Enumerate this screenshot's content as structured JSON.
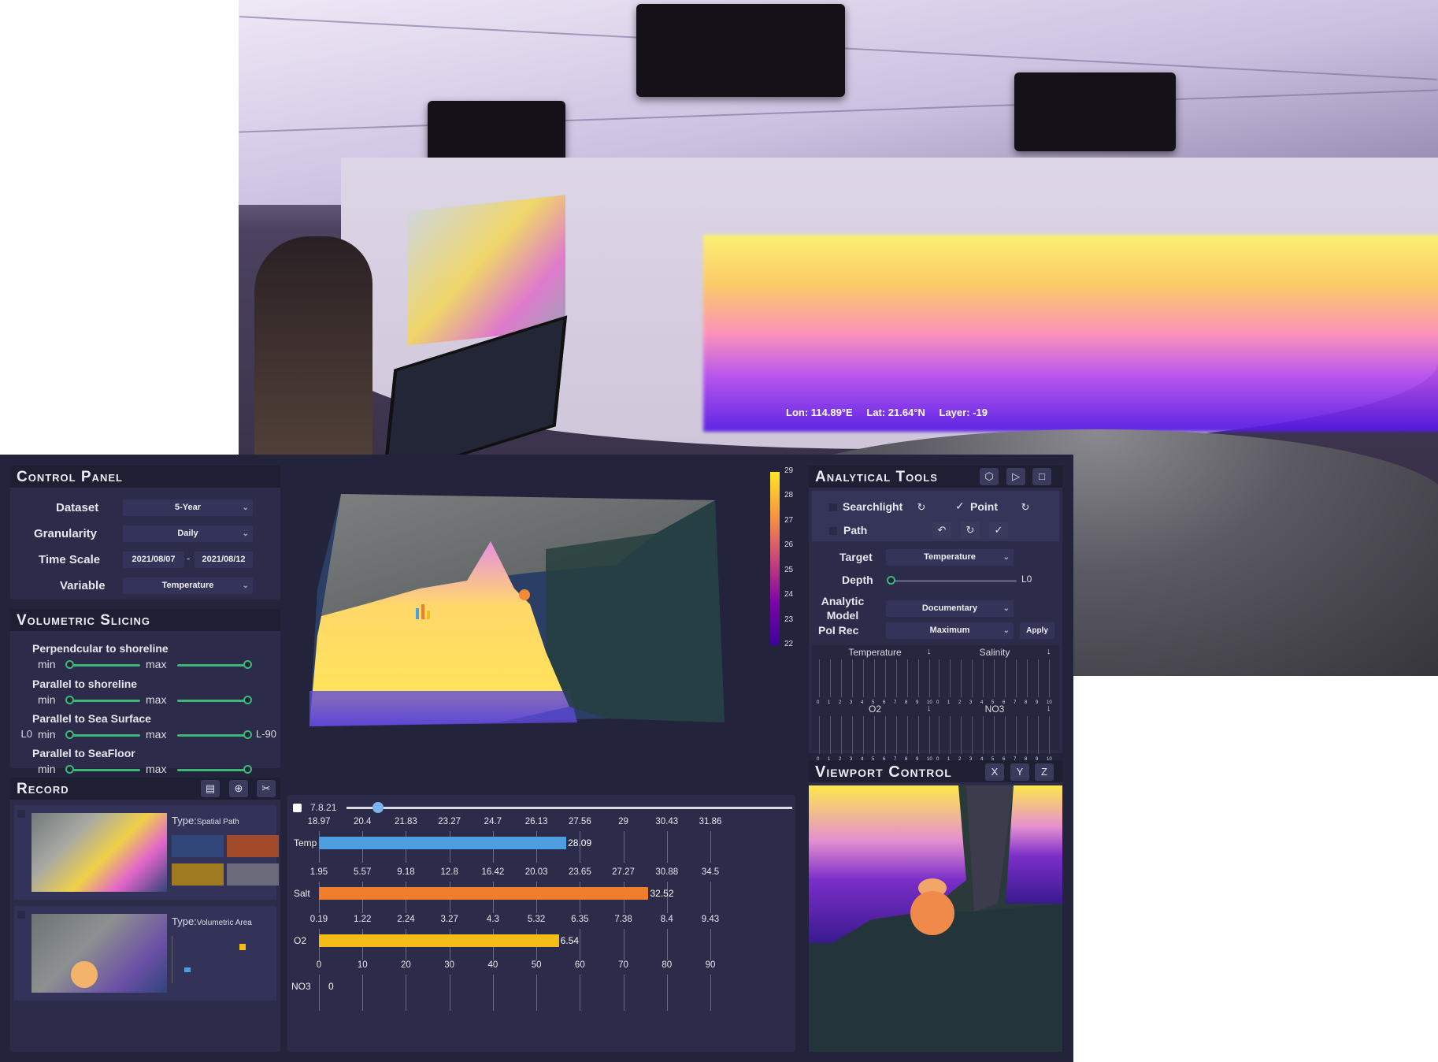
{
  "photo": {
    "lon_label": "Lon: 114.89°E",
    "lat_label": "Lat: 21.64°N",
    "layer_label": "Layer: -19"
  },
  "control_panel": {
    "title": "Control Panel",
    "rows": [
      {
        "label": "Dataset",
        "value": "5-Year"
      },
      {
        "label": "Granularity",
        "value": "Daily"
      },
      {
        "label": "Time Scale",
        "start": "2021/08/07",
        "sep": "-",
        "end": "2021/08/12"
      },
      {
        "label": "Variable",
        "value": "Temperature"
      }
    ]
  },
  "volumetric_slicing": {
    "title": "Volumetric Slicing",
    "sliders": [
      {
        "label": "Perpendcular to shoreline",
        "min_label": "min",
        "max_label": "max",
        "left_note": "",
        "right_note": ""
      },
      {
        "label": "Parallel to shoreline",
        "min_label": "min",
        "max_label": "max",
        "left_note": "",
        "right_note": ""
      },
      {
        "label": "Parallel to Sea Surface",
        "min_label": "min",
        "max_label": "max",
        "left_note": "L0",
        "right_note": "L-90"
      },
      {
        "label": "Parallel to SeaFloor",
        "min_label": "min",
        "max_label": "max",
        "left_note": "",
        "right_note": ""
      }
    ]
  },
  "record": {
    "title": "Record",
    "items": [
      {
        "type_label": "Type:",
        "type_value": "Spatial Path"
      },
      {
        "type_label": "Type:",
        "type_value": "Volumetric Area"
      }
    ]
  },
  "colorbar": {
    "ticks": [
      "29",
      "28",
      "27",
      "26",
      "25",
      "24",
      "23",
      "22"
    ],
    "colors": [
      "#fde725",
      "#f89540",
      "#cc4778",
      "#7e03a8",
      "#3a049a"
    ]
  },
  "timeline": {
    "label": "7.8.21",
    "progress": 0.07
  },
  "bars": [
    {
      "name": "Temp",
      "ticks": [
        "18.97",
        "20.4",
        "21.83",
        "23.27",
        "24.7",
        "26.13",
        "27.56",
        "29",
        "30.43",
        "31.86"
      ],
      "value_label": "28.09",
      "fraction": 0.632,
      "color": "#4d9ee0"
    },
    {
      "name": "Salt",
      "ticks": [
        "1.95",
        "5.57",
        "9.18",
        "12.8",
        "16.42",
        "20.03",
        "23.65",
        "27.27",
        "30.88",
        "34.5"
      ],
      "value_label": "32.52",
      "fraction": 0.842,
      "color": "#ef7d2c"
    },
    {
      "name": "O2",
      "ticks": [
        "0.19",
        "1.22",
        "2.24",
        "3.27",
        "4.3",
        "5.32",
        "6.35",
        "7.38",
        "8.4",
        "9.43"
      ],
      "value_label": "6.54",
      "fraction": 0.613,
      "color": "#f5bb16"
    },
    {
      "name": "NO3",
      "ticks": [
        "0",
        "10",
        "20",
        "30",
        "40",
        "50",
        "60",
        "70",
        "80",
        "90"
      ],
      "value_label": "0",
      "fraction": 0.0,
      "color": "#888888"
    }
  ],
  "analytical_tools": {
    "title": "Analytical Tools",
    "header_icons": [
      "cube-icon",
      "play-icon",
      "stop-icon"
    ],
    "searchlight_label": "Searchlight",
    "point_label": "Point",
    "path_label": "Path",
    "rows": [
      {
        "label": "Target",
        "value": "Temperature"
      },
      {
        "label": "Depth",
        "value": "L0",
        "level": 0.0
      },
      {
        "label": "Analytic Model",
        "value": "Documentary"
      },
      {
        "label": "PoI Rec",
        "value": "Maximum"
      }
    ],
    "apply_label": "Apply",
    "pcp_labels": [
      "Temperature",
      "Salinity",
      "O2",
      "NO3"
    ],
    "pcp_ticks": [
      "0",
      "1",
      "2",
      "3",
      "4",
      "5",
      "6",
      "7",
      "8",
      "9",
      "10"
    ]
  },
  "viewport_control": {
    "title": "Viewport Control",
    "axes": [
      "X",
      "Y",
      "Z"
    ]
  }
}
